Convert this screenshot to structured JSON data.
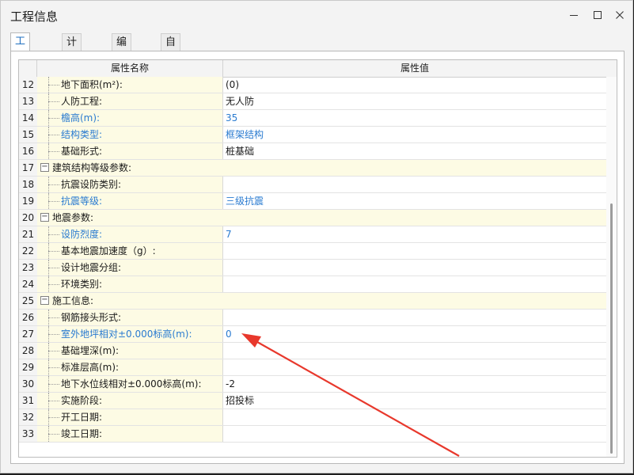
{
  "window": {
    "title": "工程信息"
  },
  "tabs": [
    {
      "label": "工程信息",
      "active": true
    },
    {
      "label": "计算规则",
      "active": false
    },
    {
      "label": "编制信息",
      "active": false
    },
    {
      "label": "自定义",
      "active": false
    }
  ],
  "table": {
    "col_name": "属性名称",
    "col_value": "属性值",
    "rows": [
      {
        "num": "12",
        "name": "地下面积(m²):",
        "value": "(0)",
        "group": false,
        "blue": false
      },
      {
        "num": "13",
        "name": "人防工程:",
        "value": "无人防",
        "group": false,
        "blue": false
      },
      {
        "num": "14",
        "name": "檐高(m):",
        "value": "35",
        "group": false,
        "blue": true
      },
      {
        "num": "15",
        "name": "结构类型:",
        "value": "框架结构",
        "group": false,
        "blue": true
      },
      {
        "num": "16",
        "name": "基础形式:",
        "value": "桩基础",
        "group": false,
        "blue": false
      },
      {
        "num": "17",
        "name": "建筑结构等级参数:",
        "value": "",
        "group": true,
        "blue": false
      },
      {
        "num": "18",
        "name": "抗震设防类别:",
        "value": "",
        "group": false,
        "blue": false
      },
      {
        "num": "19",
        "name": "抗震等级:",
        "value": "三级抗震",
        "group": false,
        "blue": true
      },
      {
        "num": "20",
        "name": "地震参数:",
        "value": "",
        "group": true,
        "blue": false
      },
      {
        "num": "21",
        "name": "设防烈度:",
        "value": "7",
        "group": false,
        "blue": true
      },
      {
        "num": "22",
        "name": "基本地震加速度（g）:",
        "value": "",
        "group": false,
        "blue": false
      },
      {
        "num": "23",
        "name": "设计地震分组:",
        "value": "",
        "group": false,
        "blue": false
      },
      {
        "num": "24",
        "name": "环境类别:",
        "value": "",
        "group": false,
        "blue": false
      },
      {
        "num": "25",
        "name": "施工信息:",
        "value": "",
        "group": true,
        "blue": false
      },
      {
        "num": "26",
        "name": "钢筋接头形式:",
        "value": "",
        "group": false,
        "blue": false
      },
      {
        "num": "27",
        "name": "室外地坪相对±0.000标高(m):",
        "value": "0",
        "group": false,
        "blue": true
      },
      {
        "num": "28",
        "name": "基础埋深(m):",
        "value": "",
        "group": false,
        "blue": false
      },
      {
        "num": "29",
        "name": "标准层高(m):",
        "value": "",
        "group": false,
        "blue": false
      },
      {
        "num": "30",
        "name": "地下水位线相对±0.000标高(m):",
        "value": "-2",
        "group": false,
        "blue": false
      },
      {
        "num": "31",
        "name": "实施阶段:",
        "value": "招投标",
        "group": false,
        "blue": false
      },
      {
        "num": "32",
        "name": "开工日期:",
        "value": "",
        "group": false,
        "blue": false
      },
      {
        "num": "33",
        "name": "竣工日期:",
        "value": "",
        "group": false,
        "blue": false
      }
    ]
  },
  "colors": {
    "accent": "#2a7bd0",
    "group_bg": "#fdfbe4",
    "arrow": "#e8382c"
  }
}
